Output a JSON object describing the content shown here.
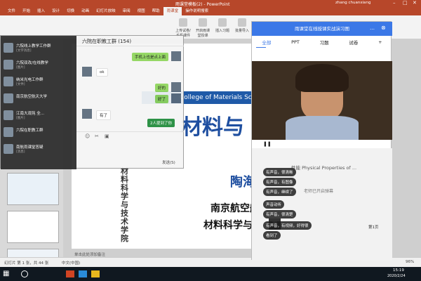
{
  "app": {
    "title": "雨课堂模板(2) - PowerPoint",
    "user": "zhang chuanxiang"
  },
  "ribbon": {
    "tabs": [
      "文件",
      "开始",
      "插入",
      "设计",
      "切换",
      "动画",
      "幻灯片放映",
      "审阅",
      "视图",
      "帮助",
      "雨课堂",
      "操作说明搜索"
    ],
    "active": "雨课堂",
    "buttons": [
      "上传试卷/手机课件",
      "开启雨课堂授课",
      "插入习题",
      "批量导入",
      "设置",
      "帮助"
    ]
  },
  "qq": {
    "group_title": "六院在职教工群 (154)",
    "contacts": [
      {
        "name": "六院线上教学工作群",
        "status": "[文字消息]"
      },
      {
        "name": "六院双改/在线教学",
        "status": "[图片]"
      },
      {
        "name": "纳米光电工作群",
        "status": "[文件]"
      },
      {
        "name": "南京航空航天大学",
        "status": ""
      },
      {
        "name": "江南大观苑 全...",
        "status": "[图片]"
      },
      {
        "name": "六院在职教工群",
        "status": ""
      },
      {
        "name": "南航雨课堂答疑",
        "status": "[消息]"
      }
    ],
    "messages": [
      {
        "text": "手机上也是点上面",
        "side": "right"
      },
      {
        "text": "ok",
        "side": "left"
      },
      {
        "text": "好的",
        "side": "right"
      },
      {
        "text": "好了",
        "side": "right"
      },
      {
        "text": "有了",
        "side": "left"
      }
    ],
    "unread": "2人提到了你",
    "send": "发送(S)"
  },
  "slide": {
    "banner": "College of Materials Sc",
    "title": "材料与",
    "vertical": "材料科学与技术学院",
    "name": "陶海",
    "line1": "南京航空航",
    "line2": "材料科学与",
    "hint": "单击此处添加备注"
  },
  "panel": {
    "header": "雨课堂在线授课实战演习图",
    "tabs": [
      "全部",
      "PPT",
      "习题",
      "试卷",
      "+"
    ],
    "danmu": [
      "有声音，很清晰",
      "有声音，有图像",
      "有声音，继续了",
      "声音动听",
      "有声音，很清楚",
      "有声音，有视频，好得很",
      "看到了"
    ],
    "slide_text": "性能 Physical Properties of ...",
    "teacher_started": "老师已开启弹幕",
    "page": "第1页",
    "danmu_btn": "弹"
  },
  "status": {
    "slide": "幻灯片 第 1 张，共 44 张",
    "lang": "中文(中国)",
    "zoom": "96%"
  },
  "taskbar": {
    "time": "15:19",
    "date": "2020/2/24"
  }
}
